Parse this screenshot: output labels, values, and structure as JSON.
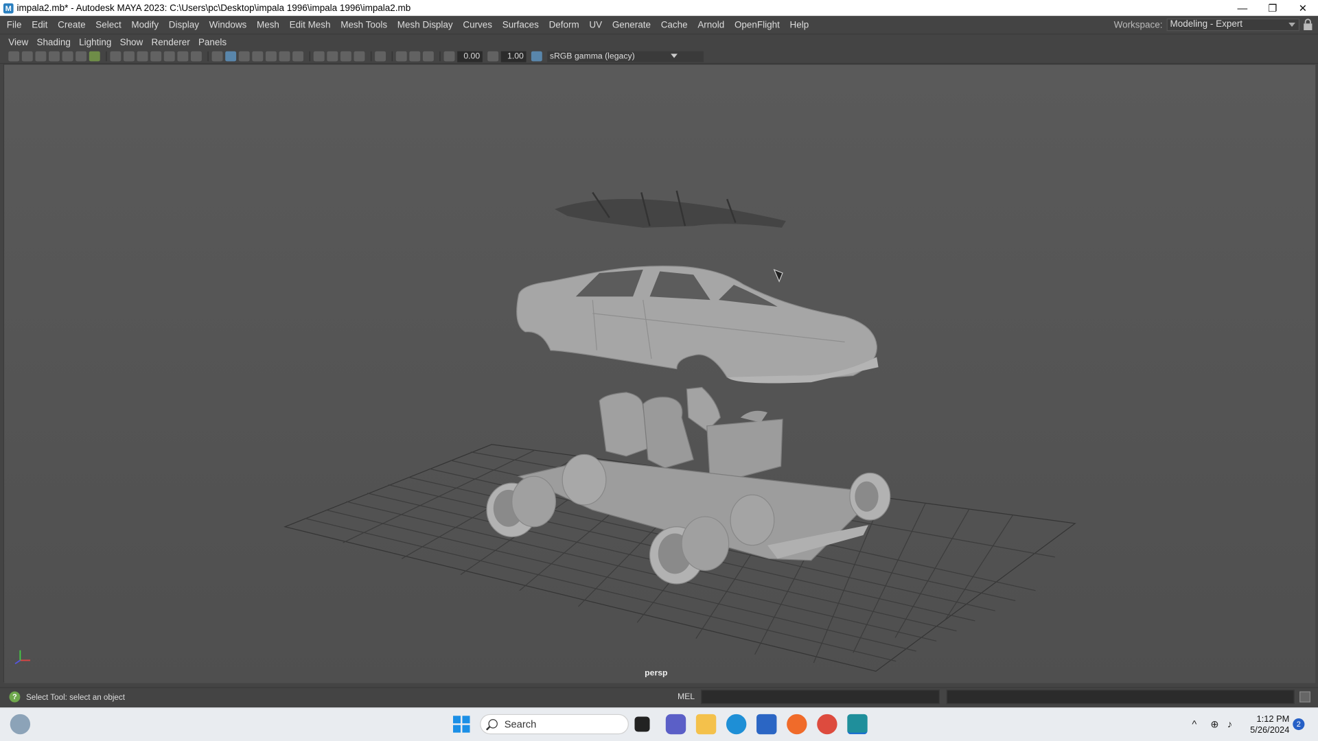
{
  "window": {
    "title": "impala2.mb* - Autodesk MAYA 2023: C:\\Users\\pc\\Desktop\\impala 1996\\impala 1996\\impala2.mb",
    "minimize": "—",
    "restore": "❐",
    "close": "✕",
    "app_icon": "M"
  },
  "menubar": {
    "items": [
      "File",
      "Edit",
      "Create",
      "Select",
      "Modify",
      "Display",
      "Windows",
      "Mesh",
      "Edit Mesh",
      "Mesh Tools",
      "Mesh Display",
      "Curves",
      "Surfaces",
      "Deform",
      "UV",
      "Generate",
      "Cache",
      "Arnold",
      "OpenFlight",
      "Help"
    ]
  },
  "workspace": {
    "label": "Workspace:",
    "value": "Modeling - Expert"
  },
  "panel_menu": {
    "items": [
      "View",
      "Shading",
      "Lighting",
      "Show",
      "Renderer",
      "Panels"
    ]
  },
  "toolbar": {
    "exposure": "0.00",
    "gamma": "1.00",
    "color_management": "sRGB gamma (legacy)"
  },
  "viewport": {
    "camera_label": "persp"
  },
  "status": {
    "help_text": "Select Tool: select an object",
    "command_type": "MEL"
  },
  "taskbar": {
    "search_placeholder": "Search",
    "time": "1:12 PM",
    "date": "5/26/2024",
    "notifications": "2"
  }
}
